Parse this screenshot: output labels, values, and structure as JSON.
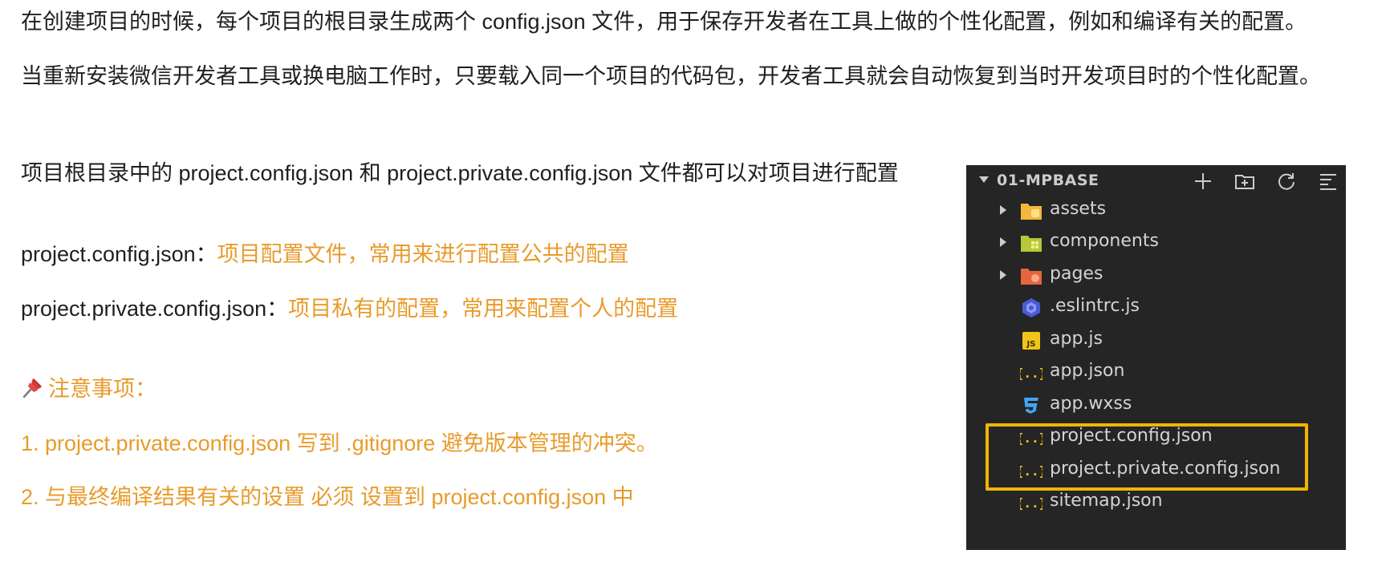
{
  "intro": {
    "line1": "在创建项目的时候，每个项目的根目录生成两个 config.json 文件，用于保存开发者在工具上做的个性化配置，例如和编译有关的配置。",
    "line2": "当重新安装微信开发者工具或换电脑工作时，只要载入同一个项目的代码包，开发者工具就会自动恢复到当时开发项目时的个性化配置。"
  },
  "config_intro": "项目根目录中的 project.config.json 和 project.private.config.json 文件都可以对项目进行配置",
  "definitions": [
    {
      "term": "project.config.json：",
      "desc": "项目配置文件，常用来进行配置公共的配置"
    },
    {
      "term": "project.private.config.json：",
      "desc": "项目私有的配置，常用来配置个人的配置"
    }
  ],
  "notes": {
    "title": "注意事项：",
    "items": [
      "1.   project.private.config.json 写到 .gitignore 避免版本管理的冲突。",
      "2.  与最终编译结果有关的设置 必须 设置到 project.config.json 中"
    ]
  },
  "explorer": {
    "title": "01-MPBASE",
    "items": [
      {
        "label": "assets",
        "icon": "folder-assets-icon",
        "folder": true
      },
      {
        "label": "components",
        "icon": "folder-components-icon",
        "folder": true
      },
      {
        "label": "pages",
        "icon": "folder-pages-icon",
        "folder": true
      },
      {
        "label": ".eslintrc.js",
        "icon": "eslint-icon",
        "folder": false
      },
      {
        "label": "app.js",
        "icon": "js-icon",
        "folder": false
      },
      {
        "label": "app.json",
        "icon": "json-icon",
        "folder": false
      },
      {
        "label": "app.wxss",
        "icon": "css-icon",
        "folder": false
      },
      {
        "label": "project.config.json",
        "icon": "json-icon",
        "folder": false
      },
      {
        "label": "project.private.config.json",
        "icon": "json-icon",
        "folder": false
      },
      {
        "label": "sitemap.json",
        "icon": "json-icon",
        "folder": false
      }
    ],
    "highlight_color": "#f2b500"
  },
  "colors": {
    "accent": "#e89b2b",
    "panel_bg": "#252526"
  }
}
